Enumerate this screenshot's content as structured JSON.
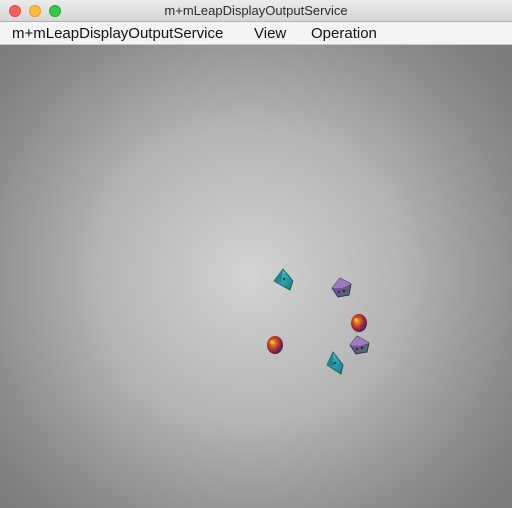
{
  "window": {
    "title": "m+mLeapDisplayOutputService"
  },
  "menu": {
    "items": [
      {
        "label": "m+mLeapDisplayOutputService"
      },
      {
        "label": "View"
      },
      {
        "label": "Operation"
      }
    ]
  },
  "scene": {
    "objects": [
      {
        "kind": "pyramid",
        "color": "#2aa9b4"
      },
      {
        "kind": "cube",
        "color": "#7a5a9a"
      },
      {
        "kind": "sphere",
        "color": "#c43a1c"
      },
      {
        "kind": "cube",
        "color": "#8a5aa0"
      },
      {
        "kind": "sphere",
        "color": "#b8321c"
      },
      {
        "kind": "pyramid",
        "color": "#2aa9b4"
      }
    ]
  }
}
